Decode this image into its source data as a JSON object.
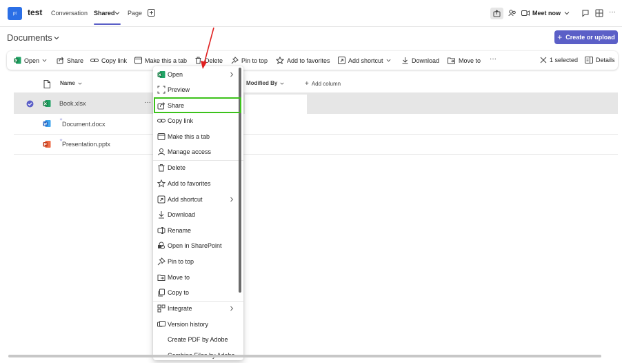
{
  "app": {
    "avatar_text": "pt",
    "team_name": "test",
    "tabs": [
      {
        "label": "Conversation"
      },
      {
        "label": "Shared",
        "active": true
      },
      {
        "label": "Page"
      }
    ],
    "meet_label": "Meet now",
    "accent_color": "#5b5fc7"
  },
  "header": {
    "title": "Documents",
    "create_label": "Create or upload"
  },
  "toolbar": {
    "open": "Open",
    "share": "Share",
    "copy_link": "Copy link",
    "make_tab": "Make this a tab",
    "delete": "Delete",
    "pin": "Pin to top",
    "favorites": "Add to favorites",
    "shortcut": "Add shortcut",
    "download": "Download",
    "move": "Move to",
    "more": "···",
    "selected": "1 selected",
    "details": "Details"
  },
  "list": {
    "columns": {
      "name": "Name",
      "modified_by": "Modified By",
      "add_column": "Add column"
    },
    "rows": [
      {
        "name": "Book.xlsx",
        "type": "excel",
        "selected": true
      },
      {
        "name": "Document.docx",
        "type": "word",
        "selected": false
      },
      {
        "name": "Presentation.pptx",
        "type": "powerpoint",
        "selected": false
      }
    ]
  },
  "menu": {
    "items": [
      {
        "label": "Open",
        "icon": "excel-icon",
        "submenu": true
      },
      {
        "label": "Preview",
        "icon": "preview-icon"
      },
      {
        "label": "Share",
        "icon": "share-icon",
        "highlighted": true
      },
      {
        "label": "Copy link",
        "icon": "link-icon"
      },
      {
        "label": "Make this a tab",
        "icon": "tab-icon"
      },
      {
        "label": "Manage access",
        "icon": "person-icon"
      },
      {
        "label": "Delete",
        "icon": "trash-icon"
      },
      {
        "label": "Add to favorites",
        "icon": "star-icon"
      },
      {
        "label": "Add shortcut",
        "icon": "shortcut-icon",
        "submenu": true
      },
      {
        "label": "Download",
        "icon": "download-icon"
      },
      {
        "label": "Rename",
        "icon": "rename-icon"
      },
      {
        "label": "Open in SharePoint",
        "icon": "sharepoint-icon"
      },
      {
        "label": "Pin to top",
        "icon": "pin-icon"
      },
      {
        "label": "Move to",
        "icon": "move-icon"
      },
      {
        "label": "Copy to",
        "icon": "copy-icon"
      },
      {
        "label": "Integrate",
        "icon": "integrate-icon",
        "submenu": true
      },
      {
        "label": "Version history",
        "icon": "history-icon"
      },
      {
        "label": "Create PDF by Adobe",
        "icon": ""
      },
      {
        "label": "Combine Files by Adobe",
        "icon": ""
      }
    ]
  },
  "annotation_color": "#e02020",
  "highlight_color": "#3cc21b"
}
